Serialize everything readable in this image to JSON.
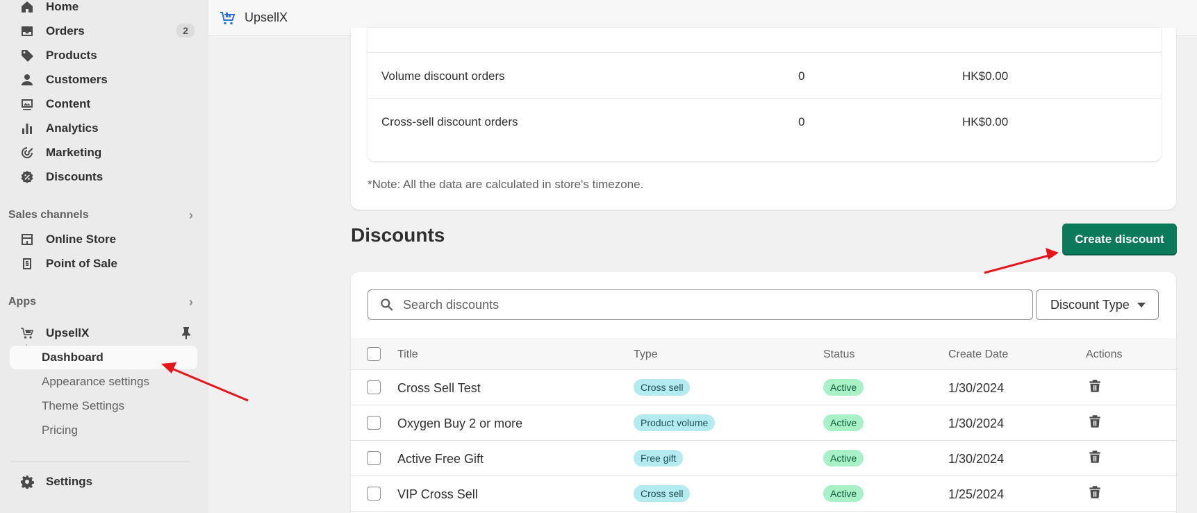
{
  "sidebar": {
    "nav": [
      {
        "label": "Home",
        "icon": "home-icon"
      },
      {
        "label": "Orders",
        "icon": "inbox-icon",
        "badge": "2"
      },
      {
        "label": "Products",
        "icon": "tag-icon"
      },
      {
        "label": "Customers",
        "icon": "person-icon"
      },
      {
        "label": "Content",
        "icon": "image-icon"
      },
      {
        "label": "Analytics",
        "icon": "bar-chart-icon"
      },
      {
        "label": "Marketing",
        "icon": "target-icon"
      },
      {
        "label": "Discounts",
        "icon": "discount-icon"
      }
    ],
    "sales_channels_label": "Sales channels",
    "channels": [
      {
        "label": "Online Store",
        "icon": "store-icon"
      },
      {
        "label": "Point of Sale",
        "icon": "pos-icon"
      }
    ],
    "apps_label": "Apps",
    "app": {
      "label": "UpsellX",
      "icon": "cart-icon"
    },
    "app_items": [
      {
        "label": "Dashboard",
        "active": true
      },
      {
        "label": "Appearance settings"
      },
      {
        "label": "Theme Settings"
      },
      {
        "label": "Pricing"
      }
    ],
    "settings_label": "Settings"
  },
  "topbar": {
    "title": "UpsellX"
  },
  "stats": {
    "rows": [
      {
        "label": "Volume discount orders",
        "count": "0",
        "amount": "HK$0.00"
      },
      {
        "label": "Cross-sell discount orders",
        "count": "0",
        "amount": "HK$0.00"
      }
    ],
    "note": "*Note: All the data are calculated in store's timezone."
  },
  "discounts": {
    "title": "Discounts",
    "create_label": "Create discount",
    "search_placeholder": "Search discounts",
    "type_filter_label": "Discount Type",
    "columns": {
      "title": "Title",
      "type": "Type",
      "status": "Status",
      "date": "Create Date",
      "actions": "Actions"
    },
    "rows": [
      {
        "title": "Cross Sell Test",
        "type": "Cross sell",
        "status": "Active",
        "date": "1/30/2024"
      },
      {
        "title": "Oxygen Buy 2 or more",
        "type": "Product volume",
        "status": "Active",
        "date": "1/30/2024"
      },
      {
        "title": "Active Free Gift",
        "type": "Free gift",
        "status": "Active",
        "date": "1/30/2024"
      },
      {
        "title": "VIP Cross Sell",
        "type": "Cross sell",
        "status": "Active",
        "date": "1/25/2024"
      }
    ]
  },
  "colors": {
    "primary_button": "#0b7a5a",
    "annotation_arrow": "#e8141b",
    "type_badge": "#b4ebf0",
    "status_badge": "#a8f0c6"
  }
}
